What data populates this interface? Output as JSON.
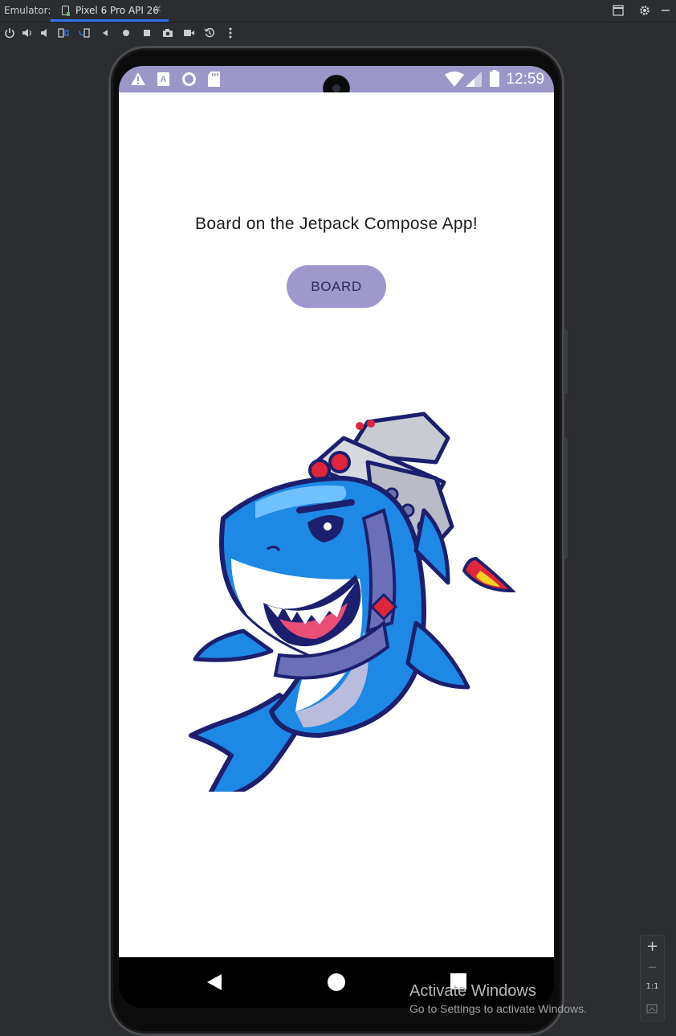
{
  "ide": {
    "emulator_label": "Emulator:",
    "device_tab": "Pixel 6 Pro API 26",
    "tab_close": "×",
    "toolbar_icons": [
      "power-icon",
      "volume-up-icon",
      "volume-down-icon",
      "rotate-left-icon",
      "rotate-right-icon",
      "back-icon",
      "home-icon",
      "overview-icon",
      "screenshot-icon",
      "record-icon",
      "snapshot-icon",
      "more-icon"
    ],
    "window_icons": [
      "window-icon",
      "settings-icon",
      "minimize-icon"
    ]
  },
  "status_bar": {
    "time": "12:59",
    "icons_left": [
      "warning-icon",
      "font-icon",
      "circle-icon",
      "sd-card-icon"
    ],
    "icons_right": [
      "wifi-icon",
      "signal-icon",
      "battery-icon"
    ],
    "color": "#9b97c9"
  },
  "app": {
    "headline": "Board on the Jetpack Compose App!",
    "button_label": "BOARD",
    "button_color": "#9e98cc",
    "image": "shark-jetpack-illustration"
  },
  "nav_bar": {
    "buttons": [
      "back-icon",
      "home-icon",
      "recents-icon"
    ]
  },
  "zoom": {
    "zoom_in": "+",
    "zoom_out": "−",
    "actual_size": "1:1"
  },
  "watermark": {
    "title": "Activate Windows",
    "subtitle": "Go to Settings to activate Windows."
  }
}
